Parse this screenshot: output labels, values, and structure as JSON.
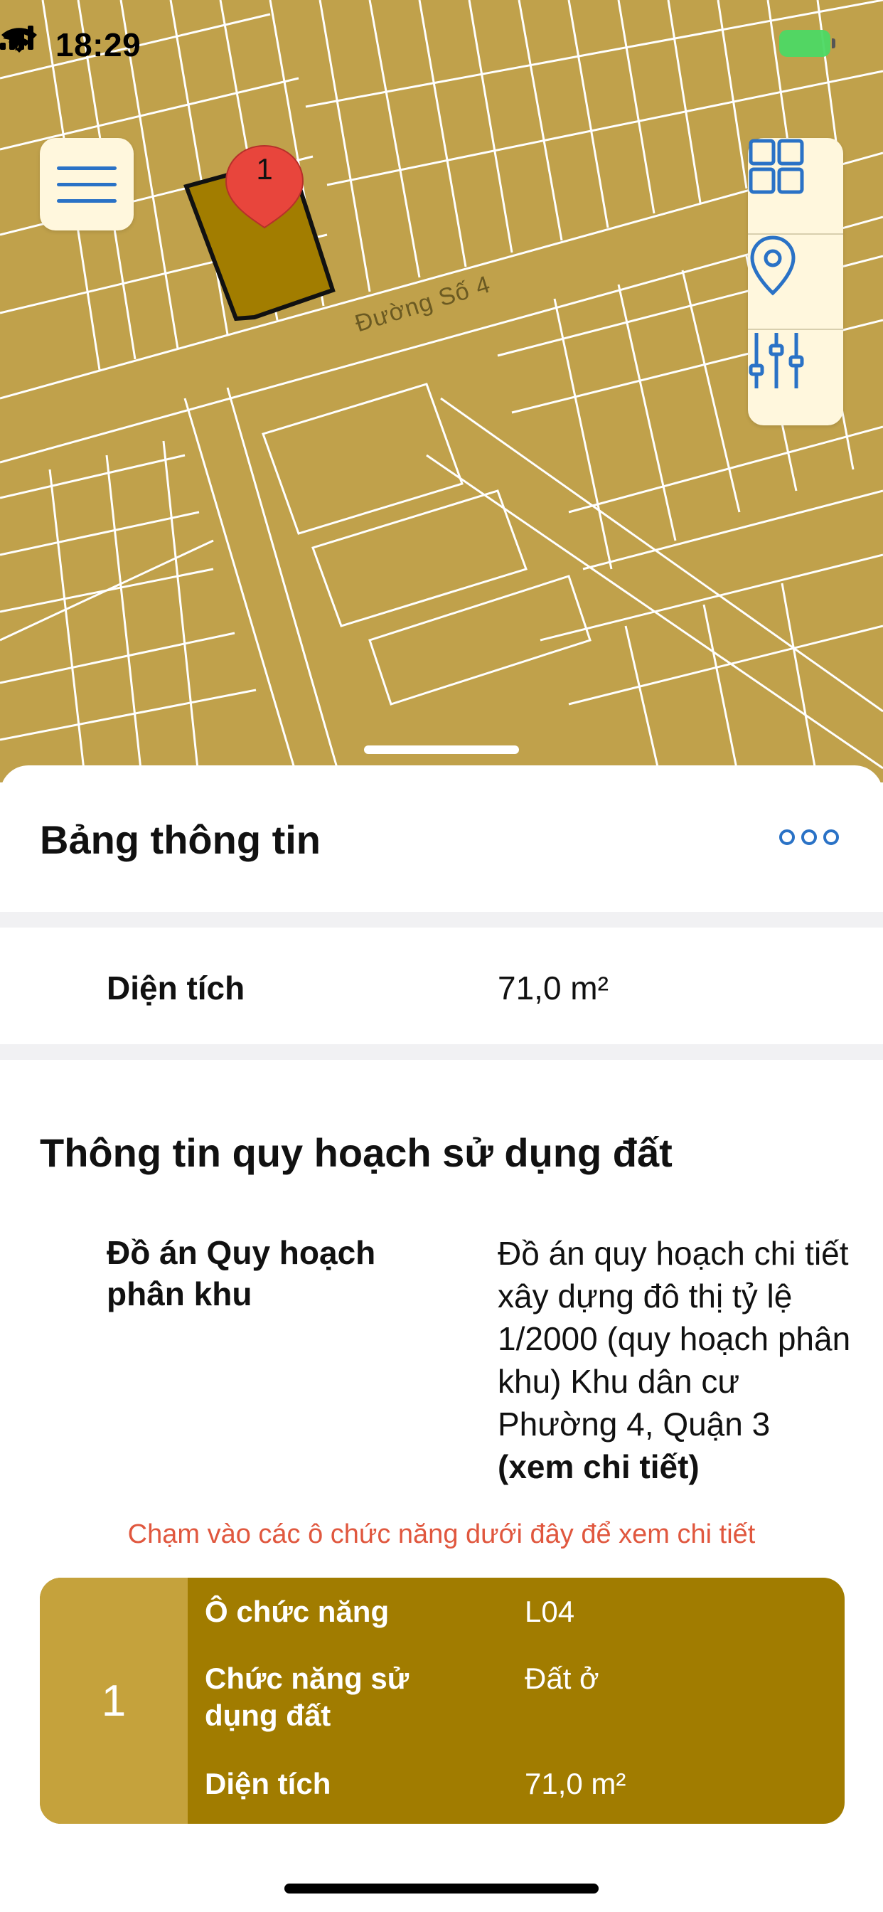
{
  "status_bar": {
    "time": "18:29",
    "battery": ""
  },
  "map": {
    "street_label": "Đường Số 4",
    "marker_label": "1",
    "colors": {
      "land": "#c0a14b",
      "parcel": "#a27d00",
      "marker": "#e8453c"
    }
  },
  "toolbar": {
    "menu_icon": "hamburger-icon",
    "grid_icon": "grid-icon",
    "location_icon": "location-pin-icon",
    "filter_icon": "sliders-icon"
  },
  "sheet": {
    "title": "Bảng thông tin",
    "area_row": {
      "label": "Diện tích",
      "value": "71,0 m²"
    },
    "planning_section": {
      "title": "Thông tin quy hoạch sử dụng đất",
      "plan_label": "Đồ án Quy hoạch phân khu",
      "plan_value": "Đồ án quy hoạch chi tiết xây dựng đô thị tỷ lệ 1/2000 (quy hoạch phân khu) Khu dân cư Phường 4, Quận 3",
      "plan_link": "(xem chi tiết)"
    },
    "hint": "Chạm vào các ô chức năng dưới đây để xem chi tiết",
    "function_card": {
      "index": "1",
      "rows": [
        {
          "label": "Ô chức năng",
          "value": "L04"
        },
        {
          "label": "Chức năng sử dụng đất",
          "value": "Đất ở"
        },
        {
          "label": "Diện tích",
          "value": "71,0 m²"
        }
      ],
      "colors": {
        "index_bg": "#c5a23c",
        "body_bg": "#a17c00"
      }
    }
  }
}
